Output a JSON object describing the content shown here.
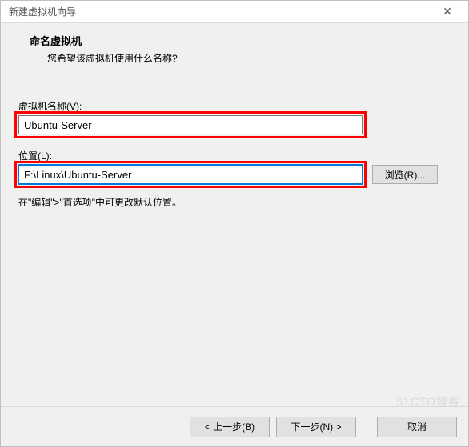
{
  "window": {
    "title": "新建虚拟机向导",
    "close_glyph": "✕"
  },
  "header": {
    "heading": "命名虚拟机",
    "subheading": "您希望该虚拟机使用什么名称?"
  },
  "fields": {
    "name_label": "虚拟机名称(V):",
    "name_value": "Ubuntu-Server",
    "location_label": "位置(L):",
    "location_value": "F:\\Linux\\Ubuntu-Server",
    "browse_label": "浏览(R)..."
  },
  "hint": "在\"编辑\">\"首选项\"中可更改默认位置。",
  "footer": {
    "back": "< 上一步(B)",
    "next": "下一步(N) >",
    "cancel": "取消"
  },
  "watermark": "51CTO博客"
}
